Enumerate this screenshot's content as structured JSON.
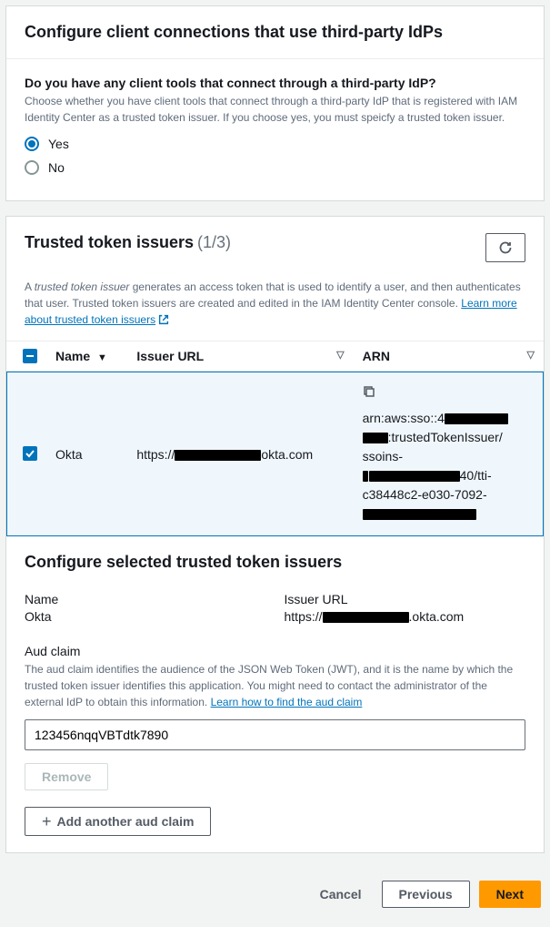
{
  "panel1": {
    "title": "Configure client connections that use third-party IdPs",
    "question": "Do you have any client tools that connect through a third-party IdP?",
    "help": "Choose whether you have client tools that connect through a third-party IdP that is registered with IAM Identity Center as a trusted token issuer. If you choose yes, you must speicfy a trusted token issuer.",
    "options": {
      "yes": "Yes",
      "no": "No"
    },
    "selected": "yes"
  },
  "panel2": {
    "title": "Trusted token issuers",
    "count": "(1/3)",
    "desc_prefix": "A ",
    "desc_em": "trusted token issuer",
    "desc_rest": " generates an access token that is used to identify a user, and then authenticates that user. Trusted token issuers are created and edited in the IAM Identity Center console. ",
    "learn_link": "Learn more about trusted token issuers",
    "columns": {
      "name": "Name",
      "url": "Issuer URL",
      "arn": "ARN"
    },
    "row": {
      "name": "Okta",
      "url_prefix": "https://",
      "url_suffix": "okta.com",
      "arn_line1_prefix": "arn:aws:sso::4",
      "arn_line2_suffix": ":trustedTokenIssuer/",
      "arn_line3": "ssoins-",
      "arn_line4_suffix": "40/tti-",
      "arn_line5": "c38448c2-e030-7092-"
    }
  },
  "config": {
    "title": "Configure selected trusted token issuers",
    "name_label": "Name",
    "name_value": "Okta",
    "url_label": "Issuer URL",
    "url_prefix": "https://",
    "url_suffix": ".okta.com",
    "aud_label": "Aud claim",
    "aud_help": "The aud claim identifies the audience of the JSON Web Token (JWT), and it is the name by which the trusted token issuer identifies this application. You might need to contact the administrator of the external IdP to obtain this information. ",
    "aud_link": "Learn how to find the aud claim",
    "aud_value": "123456nqqVBTdtk7890",
    "remove_btn": "Remove",
    "add_btn": "Add another aud claim"
  },
  "footer": {
    "cancel": "Cancel",
    "previous": "Previous",
    "next": "Next"
  }
}
